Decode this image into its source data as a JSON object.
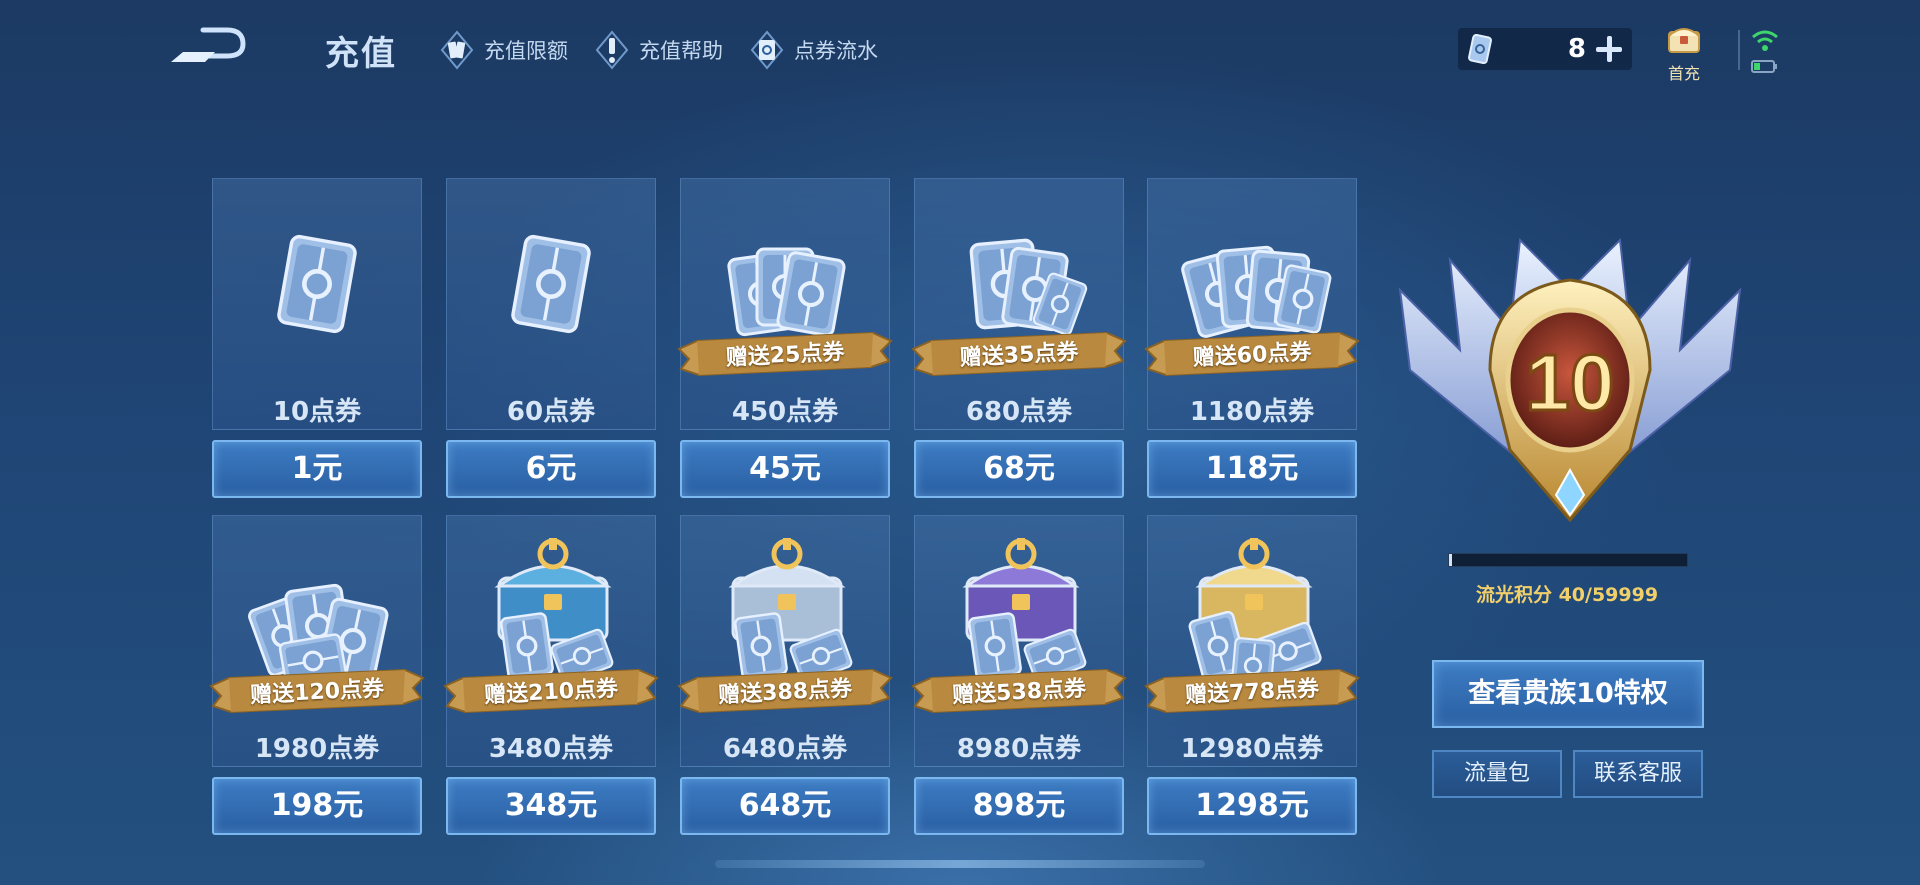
{
  "header": {
    "title": "充值",
    "links": [
      {
        "label": "充值限额",
        "icon": "card-icon"
      },
      {
        "label": "充值帮助",
        "icon": "exclamation-icon"
      },
      {
        "label": "点券流水",
        "icon": "voucher-icon"
      }
    ],
    "currency": {
      "amount": "8",
      "icon": "voucher-icon"
    },
    "first_charge_label": "首充"
  },
  "products": [
    {
      "amount_label": "10点券",
      "price_label": "1元",
      "bonus": "",
      "art": "single-card"
    },
    {
      "amount_label": "60点券",
      "price_label": "6元",
      "bonus": "",
      "art": "single-card"
    },
    {
      "amount_label": "450点券",
      "price_label": "45元",
      "bonus": "赠送25点券",
      "art": "card-fan"
    },
    {
      "amount_label": "680点券",
      "price_label": "68元",
      "bonus": "赠送35点券",
      "art": "card-stack"
    },
    {
      "amount_label": "1180点券",
      "price_label": "118元",
      "bonus": "赠送60点券",
      "art": "card-pile"
    },
    {
      "amount_label": "1980点券",
      "price_label": "198元",
      "bonus": "赠送120点券",
      "art": "card-heap"
    },
    {
      "amount_label": "3480点券",
      "price_label": "348元",
      "bonus": "赠送210点券",
      "art": "blue-chest"
    },
    {
      "amount_label": "6480点券",
      "price_label": "648元",
      "bonus": "赠送388点券",
      "art": "silver-chest"
    },
    {
      "amount_label": "8980点券",
      "price_label": "898元",
      "bonus": "赠送538点券",
      "art": "purple-chest"
    },
    {
      "amount_label": "12980点券",
      "price_label": "1298元",
      "bonus": "赠送778点券",
      "art": "gold-chest"
    }
  ],
  "noble": {
    "level": "10",
    "points_label": "流光积分",
    "points_value": "40/59999",
    "progress_fraction": 0.0007,
    "view_button": "查看贵族10特权",
    "traffic_button": "流量包",
    "support_button": "联系客服"
  },
  "colors": {
    "accent_gold": "#f1cf6a",
    "button_blue": "#2f6bb0",
    "background": "#1f4575"
  }
}
